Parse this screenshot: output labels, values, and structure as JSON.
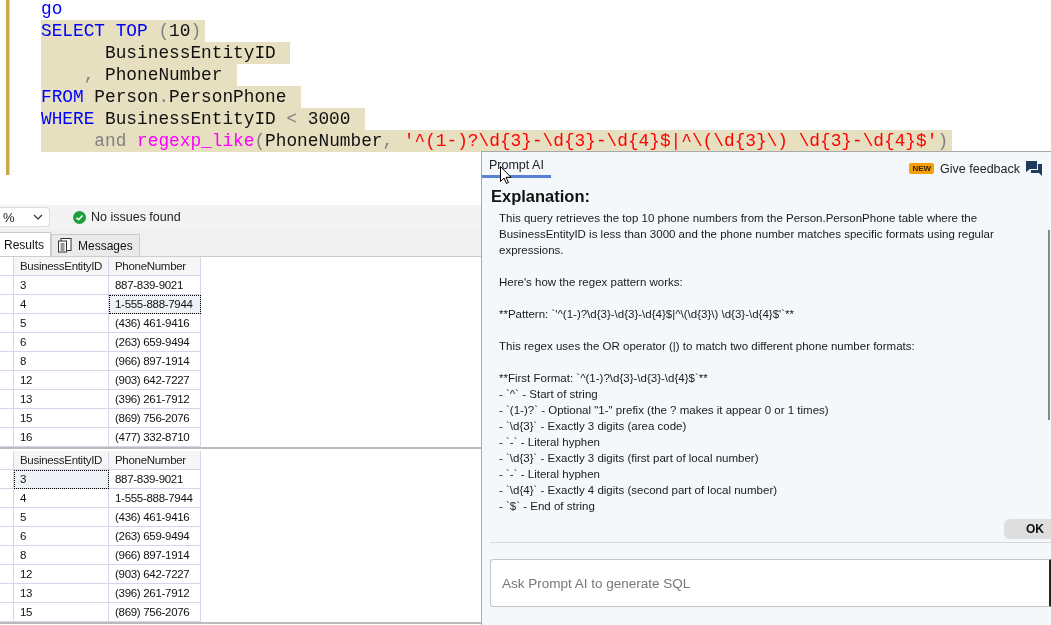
{
  "editor": {
    "lines": [
      {
        "selected": false,
        "tokens": [
          {
            "kind": "keyword",
            "text": "go"
          }
        ]
      },
      {
        "selected": true,
        "tokens": [
          {
            "kind": "keyword",
            "text": "SELECT TOP "
          },
          {
            "kind": "operator",
            "text": "("
          },
          {
            "kind": "plain",
            "text": "10"
          },
          {
            "kind": "operator",
            "text": ")"
          }
        ]
      },
      {
        "selected": true,
        "tokens": [
          {
            "kind": "plain",
            "text": "      BusinessEntityID "
          }
        ]
      },
      {
        "selected": true,
        "tokens": [
          {
            "kind": "operator",
            "text": "    , "
          },
          {
            "kind": "plain",
            "text": "PhoneNumber "
          }
        ]
      },
      {
        "selected": true,
        "tokens": [
          {
            "kind": "keyword",
            "text": "FROM "
          },
          {
            "kind": "plain",
            "text": "Person"
          },
          {
            "kind": "operator",
            "text": "."
          },
          {
            "kind": "plain",
            "text": "PersonPhone "
          }
        ]
      },
      {
        "selected": true,
        "tokens": [
          {
            "kind": "keyword",
            "text": "WHERE "
          },
          {
            "kind": "plain",
            "text": "BusinessEntityID "
          },
          {
            "kind": "operator",
            "text": "< "
          },
          {
            "kind": "plain",
            "text": "3000 "
          }
        ]
      },
      {
        "selected": true,
        "tokens": [
          {
            "kind": "operator",
            "text": "     and "
          },
          {
            "kind": "function",
            "text": "regexp_like"
          },
          {
            "kind": "operator",
            "text": "("
          },
          {
            "kind": "plain",
            "text": "PhoneNumber"
          },
          {
            "kind": "operator",
            "text": ", "
          },
          {
            "kind": "string",
            "text": "'^(1-)?\\d{3}-\\d{3}-\\d{4}$|^\\(\\d{3}\\) \\d{3}-\\d{4}$'"
          },
          {
            "kind": "operator",
            "text": ")"
          }
        ]
      }
    ]
  },
  "toolbar": {
    "zoom": "%",
    "status": "No issues found"
  },
  "result_tabs": [
    {
      "label": "Results",
      "selected": true
    },
    {
      "label": "Messages",
      "selected": false
    }
  ],
  "grids": [
    {
      "columns": [
        "BusinessEntityID",
        "PhoneNumber"
      ],
      "rows": [
        {
          "cells": [
            {
              "text": "3",
              "selected": false
            },
            {
              "text": "887-839-9021",
              "selected": false
            }
          ]
        },
        {
          "cells": [
            {
              "text": "4",
              "selected": false
            },
            {
              "text": "1-555-888-7944",
              "selected": true
            }
          ]
        },
        {
          "cells": [
            {
              "text": "5",
              "selected": false
            },
            {
              "text": "(436) 461-9416",
              "selected": false
            }
          ]
        },
        {
          "cells": [
            {
              "text": "6",
              "selected": false
            },
            {
              "text": "(263) 659-9494",
              "selected": false
            }
          ]
        },
        {
          "cells": [
            {
              "text": "8",
              "selected": false
            },
            {
              "text": "(966) 897-1914",
              "selected": false
            }
          ]
        },
        {
          "cells": [
            {
              "text": "12",
              "selected": false
            },
            {
              "text": "(903) 642-7227",
              "selected": false
            }
          ]
        },
        {
          "cells": [
            {
              "text": "13",
              "selected": false
            },
            {
              "text": "(396) 261-7912",
              "selected": false
            }
          ]
        },
        {
          "cells": [
            {
              "text": "15",
              "selected": false
            },
            {
              "text": "(869) 756-2076",
              "selected": false
            }
          ]
        },
        {
          "cells": [
            {
              "text": "16",
              "selected": false
            },
            {
              "text": "(477) 332-8710",
              "selected": false
            }
          ]
        }
      ]
    },
    {
      "columns": [
        "BusinessEntityID",
        "PhoneNumber"
      ],
      "rows": [
        {
          "cells": [
            {
              "text": "3",
              "selected": true
            },
            {
              "text": "887-839-9021",
              "selected": false
            }
          ]
        },
        {
          "cells": [
            {
              "text": "4",
              "selected": false
            },
            {
              "text": "1-555-888-7944",
              "selected": false
            }
          ]
        },
        {
          "cells": [
            {
              "text": "5",
              "selected": false
            },
            {
              "text": "(436) 461-9416",
              "selected": false
            }
          ]
        },
        {
          "cells": [
            {
              "text": "6",
              "selected": false
            },
            {
              "text": "(263) 659-9494",
              "selected": false
            }
          ]
        },
        {
          "cells": [
            {
              "text": "8",
              "selected": false
            },
            {
              "text": "(966) 897-1914",
              "selected": false
            }
          ]
        },
        {
          "cells": [
            {
              "text": "12",
              "selected": false
            },
            {
              "text": "(903) 642-7227",
              "selected": false
            }
          ]
        },
        {
          "cells": [
            {
              "text": "13",
              "selected": false
            },
            {
              "text": "(396) 261-7912",
              "selected": false
            }
          ]
        },
        {
          "cells": [
            {
              "text": "15",
              "selected": false
            },
            {
              "text": "(869) 756-2076",
              "selected": false
            }
          ]
        }
      ]
    }
  ],
  "ai_panel": {
    "tabs": [
      {
        "label": "Prompt AI",
        "selected": true
      }
    ],
    "badge": "NEW",
    "feedback": "Give feedback",
    "heading": "Explanation:",
    "paragraphs": [
      {
        "lines": [
          "This query retrieves the top 10 phone numbers from the Person.PersonPhone table where the BusinessEntityID is less than 3000 and the phone number matches specific formats using regular expressions."
        ]
      },
      {
        "lines": [
          "Here's how the regex pattern works:"
        ]
      },
      {
        "lines": [
          "**Pattern: `'^(1-)?\\d{3}-\\d{3}-\\d{4}$|^\\(\\d{3}\\) \\d{3}-\\d{4}$'`**"
        ]
      },
      {
        "lines": [
          "This regex uses the OR operator (|) to match two different phone number formats:"
        ]
      },
      {
        "lines": [
          "**First Format: `^(1-)?\\d{3}-\\d{3}-\\d{4}$`**",
          "- `^` - Start of string",
          "- `(1-)?` - Optional \"1-\" prefix (the ? makes it appear 0 or 1 times)",
          "- `\\d{3}` - Exactly 3 digits (area code)",
          "- `-` - Literal hyphen",
          "- `\\d{3}` - Exactly 3 digits (first part of local number)",
          "- `-` - Literal hyphen",
          "- `\\d{4}` - Exactly 4 digits (second part of local number)",
          "- `$` - End of string"
        ]
      }
    ],
    "ok_button": "OK",
    "input": {
      "placeholder": "Ask Prompt AI to generate SQL"
    }
  }
}
